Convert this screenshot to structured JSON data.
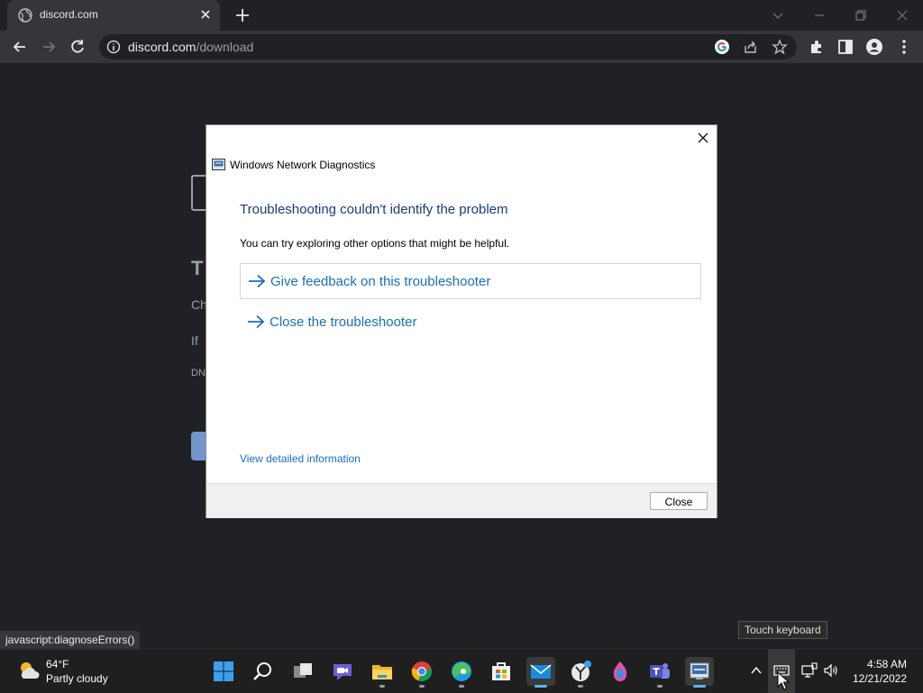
{
  "browser": {
    "tab_title": "discord.com",
    "url_host": "discord.com",
    "url_path": "/download",
    "status_text": "javascript:diagnoseErrors()"
  },
  "dialog": {
    "window_title": "Windows Network Diagnostics",
    "heading": "Troubleshooting couldn't identify the problem",
    "subtext": "You can try exploring other options that might be helpful.",
    "options": [
      {
        "label": "Give feedback on this troubleshooter",
        "focused": true
      },
      {
        "label": "Close the troubleshooter",
        "focused": false
      }
    ],
    "details_link": "View detailed information",
    "close_button": "Close"
  },
  "taskbar": {
    "weather_temp": "64°F",
    "weather_condition": "Partly cloudy",
    "tooltip": "Touch keyboard",
    "time": "4:58 AM",
    "date": "12/21/2022",
    "apps": [
      "start-icon",
      "search-icon",
      "task-view-icon",
      "chat-icon",
      "file-explorer-icon",
      "chrome-icon",
      "edge-icon",
      "store-icon",
      "mail-icon",
      "app-icon",
      "paint-icon",
      "teams-icon",
      "network-diagnostics-icon"
    ]
  },
  "colors": {
    "link_blue": "#1a6fb9",
    "heading_navy": "#1c3a7a",
    "chrome_dark": "#202124",
    "chrome_toolbar": "#35363a"
  }
}
